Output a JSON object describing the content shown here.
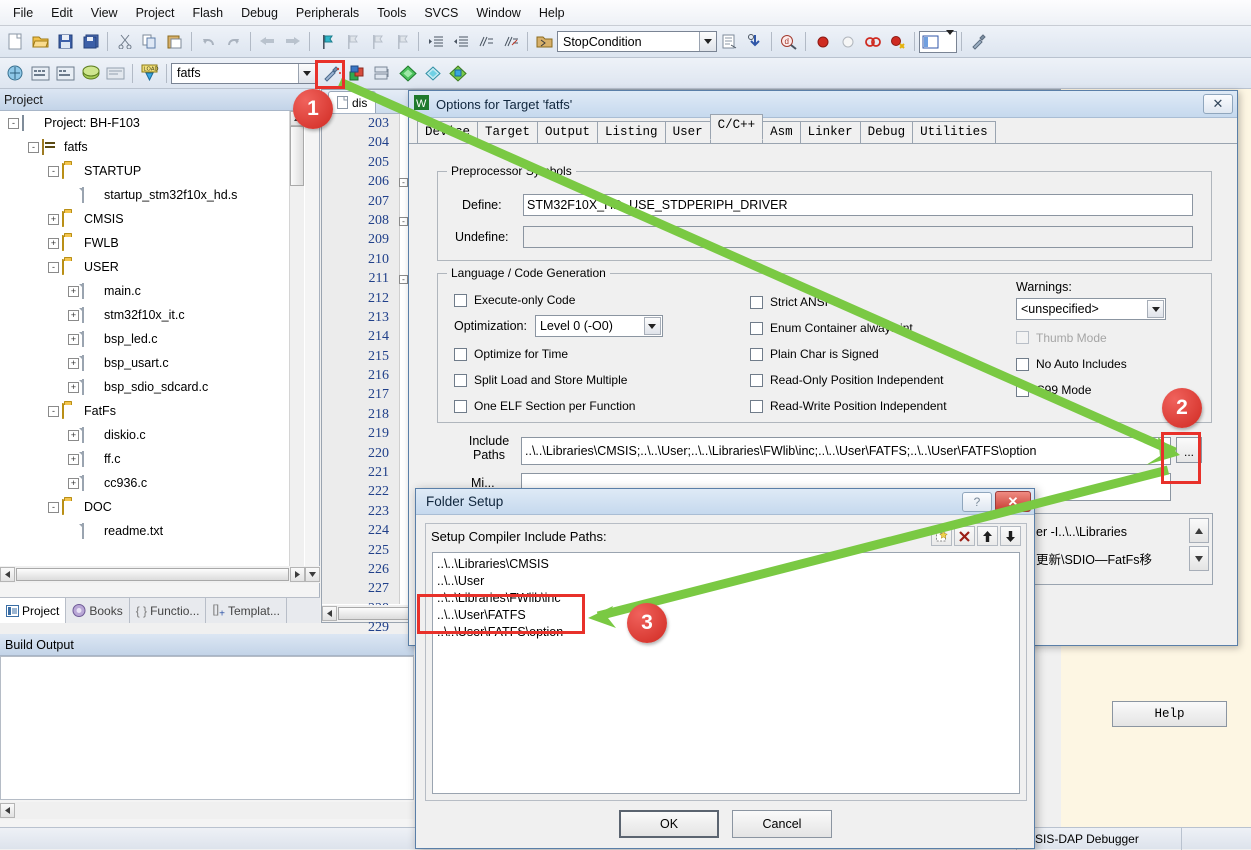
{
  "app": {
    "menu": [
      "File",
      "Edit",
      "View",
      "Project",
      "Flash",
      "Debug",
      "Peripherals",
      "Tools",
      "SVCS",
      "Window",
      "Help"
    ],
    "toolbar1_icons": [
      "new-file-icon",
      "open-file-icon",
      "save-icon",
      "save-all-icon",
      "cut-icon",
      "copy-icon",
      "paste-icon",
      "undo-icon",
      "redo-icon",
      "navigate-back-icon",
      "navigate-forward-icon",
      "bookmark-toggle-icon",
      "bookmark-prev-icon",
      "bookmark-next-icon",
      "bookmark-clear-icon",
      "indent-icon",
      "outdent-icon",
      "comment-icon",
      "uncomment-icon",
      "open-source-browser-icon"
    ],
    "toolbar1_combo_value": "StopCondition",
    "toolbar1_tail_icons": [
      "insert-file-icon",
      "find-in-files-icon",
      "find-icon",
      "breakpoint-insert-icon",
      "breakpoint-disable-icon",
      "breakpoint-kill-all-icon",
      "breakpoint-disable-all-icon",
      "project-window-icon",
      "configuration-wizard-icon"
    ],
    "toolbar2_icons": [
      "build-target-icon",
      "rebuild-all-icon",
      "batch-build-icon",
      "stop-build-icon",
      "download-icon",
      "load-flash-icon"
    ],
    "toolbar2_combo_value": "fatfs",
    "toolbar2_tail_icons": [
      "target-options-icon",
      "manage-runtime-env-icon",
      "multi-project-icon",
      "new-target-icon",
      "new-group-icon",
      "new-component-icon"
    ]
  },
  "project_panel": {
    "title": "Project",
    "pin_icon": "pin-icon",
    "tree": [
      {
        "indent": 0,
        "label": "Project: BH-F103",
        "expander": "-",
        "icon": "project-icon"
      },
      {
        "indent": 1,
        "label": "fatfs",
        "expander": "-",
        "icon": "target-icon"
      },
      {
        "indent": 2,
        "label": "STARTUP",
        "expander": "-",
        "icon": "folder-open-icon"
      },
      {
        "indent": 3,
        "label": "startup_stm32f10x_hd.s",
        "expander": "",
        "icon": "file-icon"
      },
      {
        "indent": 2,
        "label": "CMSIS",
        "expander": "+",
        "icon": "folder-icon"
      },
      {
        "indent": 2,
        "label": "FWLB",
        "expander": "+",
        "icon": "folder-icon"
      },
      {
        "indent": 2,
        "label": "USER",
        "expander": "-",
        "icon": "folder-open-icon"
      },
      {
        "indent": 3,
        "label": "main.c",
        "expander": "+",
        "icon": "file-icon"
      },
      {
        "indent": 3,
        "label": "stm32f10x_it.c",
        "expander": "+",
        "icon": "file-icon"
      },
      {
        "indent": 3,
        "label": "bsp_led.c",
        "expander": "+",
        "icon": "file-icon"
      },
      {
        "indent": 3,
        "label": "bsp_usart.c",
        "expander": "+",
        "icon": "file-icon"
      },
      {
        "indent": 3,
        "label": "bsp_sdio_sdcard.c",
        "expander": "+",
        "icon": "file-icon"
      },
      {
        "indent": 2,
        "label": "FatFs",
        "expander": "-",
        "icon": "folder-open-icon"
      },
      {
        "indent": 3,
        "label": "diskio.c",
        "expander": "+",
        "icon": "file-icon"
      },
      {
        "indent": 3,
        "label": "ff.c",
        "expander": "+",
        "icon": "file-icon"
      },
      {
        "indent": 3,
        "label": "cc936.c",
        "expander": "+",
        "icon": "file-icon"
      },
      {
        "indent": 2,
        "label": "DOC",
        "expander": "-",
        "icon": "folder-open-icon"
      },
      {
        "indent": 3,
        "label": "readme.txt",
        "expander": "",
        "icon": "file-icon"
      }
    ],
    "tabs": [
      {
        "label": "Project",
        "icon": "project-tab-icon",
        "active": true
      },
      {
        "label": "Books",
        "icon": "books-tab-icon",
        "active": false
      },
      {
        "label": "Functio...",
        "icon": "functions-tab-icon",
        "active": false
      },
      {
        "label": "Templat...",
        "icon": "templates-tab-icon",
        "active": false
      }
    ]
  },
  "editor": {
    "tab_label": "dis",
    "tab_icon": "file-icon",
    "line_numbers": [
      "203",
      "204",
      "205",
      "206",
      "207",
      "208",
      "209",
      "210",
      "211",
      "212",
      "213",
      "214",
      "215",
      "216",
      "217",
      "218",
      "219",
      "220",
      "221",
      "222",
      "223",
      "224",
      "225",
      "226",
      "227",
      "228",
      "229"
    ],
    "fold_lines": [
      "206",
      "208",
      "211"
    ]
  },
  "build_output": {
    "title": "Build Output",
    "content": ""
  },
  "statusbar": {
    "debugger": "MSIS-DAP Debugger"
  },
  "options_dialog": {
    "title": "Options for Target 'fatfs'",
    "app_icon": "uvision-icon",
    "close_label": "✕",
    "tabs": [
      {
        "label": "Device",
        "active": false
      },
      {
        "label": "Target",
        "active": false
      },
      {
        "label": "Output",
        "active": false
      },
      {
        "label": "Listing",
        "active": false
      },
      {
        "label": "User",
        "active": false
      },
      {
        "label": "C/C++",
        "active": true
      },
      {
        "label": "Asm",
        "active": false
      },
      {
        "label": "Linker",
        "active": false
      },
      {
        "label": "Debug",
        "active": false
      },
      {
        "label": "Utilities",
        "active": false
      }
    ],
    "preprocessor": {
      "legend": "Preprocessor Symbols",
      "define_label": "Define:",
      "define_value": "STM32F10X_HD, USE_STDPERIPH_DRIVER",
      "undefine_label": "Undefine:",
      "undefine_value": ""
    },
    "language": {
      "legend": "Language / Code Generation",
      "left_checks": [
        {
          "label": "Execute-only Code",
          "checked": false
        },
        {
          "label": "Optimize for Time",
          "checked": false
        },
        {
          "label": "Split Load and Store Multiple",
          "checked": false
        },
        {
          "label": "One ELF Section per Function",
          "checked": false
        }
      ],
      "optimization_label": "Optimization:",
      "optimization_value": "Level 0 (-O0)",
      "middle_checks": [
        {
          "label": "Strict ANSI C",
          "checked": false,
          "disabled": false
        },
        {
          "label": "Enum Container always int",
          "checked": false,
          "disabled": false
        },
        {
          "label": "Plain Char is Signed",
          "checked": false,
          "disabled": false
        },
        {
          "label": "Read-Only Position Independent",
          "checked": false,
          "disabled": false
        },
        {
          "label": "Read-Write Position Independent",
          "checked": false,
          "disabled": false
        }
      ],
      "warnings_label": "Warnings:",
      "warnings_value": "<unspecified>",
      "right_checks": [
        {
          "label": "Thumb Mode",
          "checked": false,
          "disabled": true
        },
        {
          "label": "No Auto Includes",
          "checked": false,
          "disabled": false
        },
        {
          "label": "C99 Mode",
          "checked": false,
          "disabled": false
        }
      ]
    },
    "include_paths_label": "Include\nPaths",
    "include_paths_value": "..\\..\\Libraries\\CMSIS;..\\..\\User;..\\..\\Libraries\\FWlib\\inc;..\\..\\User\\FATFS;..\\..\\User\\FATFS\\option",
    "include_browse_label": "...",
    "misc_label": "Mi...",
    "misc_value": "",
    "compiler_control_lines": [
      "er -I..\\..\\Libraries",
      "更新\\SDIO—FatFs移"
    ],
    "help_label": "Help"
  },
  "folder_dialog": {
    "title": "Folder Setup",
    "help_label": "?",
    "close_label": "✕",
    "list_label": "Setup Compiler Include Paths:",
    "toolbar_icons": [
      "new-path-icon",
      "delete-path-icon",
      "move-up-icon",
      "move-down-icon"
    ],
    "paths": [
      "..\\..\\Libraries\\CMSIS",
      "..\\..\\User",
      "..\\..\\Libraries\\FWlib\\inc",
      "..\\..\\User\\FATFS",
      "..\\..\\User\\FATFS\\option"
    ],
    "ok_label": "OK",
    "cancel_label": "Cancel"
  },
  "annotations": {
    "badges": [
      "1",
      "2",
      "3"
    ],
    "highlight_color": "#e8312a",
    "arrow_color": "#7ac943"
  }
}
